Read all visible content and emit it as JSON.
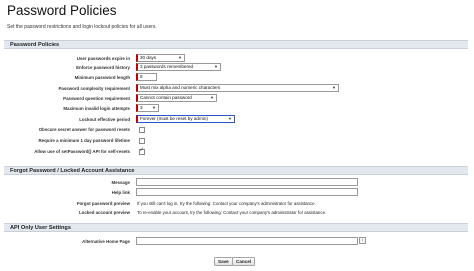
{
  "page": {
    "title": "Password Policies",
    "description": "Set the password restrictions and login lockout policies for all users."
  },
  "sections": {
    "password_policies": "Password Policies",
    "forgot_password": "Forgot Password / Locked Account Assistance",
    "api_only": "API Only User Settings"
  },
  "policies": {
    "expire_label": "User passwords expire in",
    "expire_value": "30 days",
    "history_label": "Enforce password history",
    "history_value": "3 passwords remembered",
    "min_length_label": "Minimum password length",
    "min_length_value": "8",
    "complexity_label": "Password complexity requirement",
    "complexity_value": "Must mix alpha and numeric characters",
    "question_label": "Password question requirement",
    "question_value": "Cannot contain password",
    "max_attempts_label": "Maximum invalid login attempts",
    "max_attempts_value": "3",
    "lockout_label": "Lockout effective period",
    "lockout_value": "Forever (must be reset by admin)",
    "obscure_label": "Obscure secret answer for password resets",
    "min_lifetime_label": "Require a minimum 1 day password lifetime",
    "api_reset_label": "Allow use of setPassword() API for self-resets"
  },
  "forgot": {
    "message_label": "Message",
    "help_link_label": "Help link",
    "forgot_preview_label": "Forgot password preview",
    "forgot_preview_text": "If you still can't log in, try the following: Contact your company's administrator for assistance.",
    "locked_preview_label": "Locked account preview",
    "locked_preview_text": "To re-enable your account, try the following: Contact your company's administrator for assistance."
  },
  "api": {
    "home_page_label": "Alternative Home Page"
  },
  "buttons": {
    "save": "Save",
    "cancel": "Cancel"
  },
  "colors": {
    "required_bar": "#c00000",
    "section_bg": "#e3e8ee"
  }
}
